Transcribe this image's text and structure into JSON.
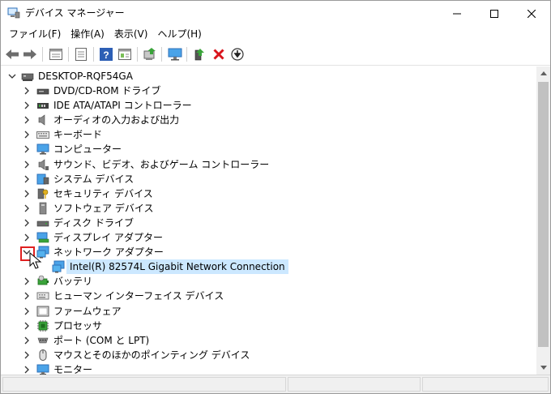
{
  "window": {
    "title": "デバイス マネージャー",
    "icon": "device-manager-icon"
  },
  "menu": [
    "ファイル(F)",
    "操作(A)",
    "表示(V)",
    "ヘルプ(H)"
  ],
  "toolbar": {
    "buttons": [
      "back-arrow-icon",
      "forward-arrow-icon",
      "properties-icon",
      "document-icon",
      "help-icon",
      "view-icon",
      "update-driver-icon",
      "monitor-icon",
      "enable-device-icon",
      "uninstall-x-icon",
      "download-driver-icon"
    ]
  },
  "tree": {
    "root": "DESKTOP-RQF54GA",
    "categories": [
      {
        "label": "DVD/CD-ROM ドライブ",
        "icon": "dvd-drive-icon"
      },
      {
        "label": "IDE ATA/ATAPI コントローラー",
        "icon": "ide-controller-icon"
      },
      {
        "label": "オーディオの入力および出力",
        "icon": "speaker-icon"
      },
      {
        "label": "キーボード",
        "icon": "keyboard-icon"
      },
      {
        "label": "コンピューター",
        "icon": "computer-icon"
      },
      {
        "label": "サウンド、ビデオ、およびゲーム コントローラー",
        "icon": "sound-icon"
      },
      {
        "label": "システム デバイス",
        "icon": "system-device-icon"
      },
      {
        "label": "セキュリティ デバイス",
        "icon": "security-key-icon"
      },
      {
        "label": "ソフトウェア デバイス",
        "icon": "software-device-icon"
      },
      {
        "label": "ディスク ドライブ",
        "icon": "disk-drive-icon"
      },
      {
        "label": "ディスプレイ アダプター",
        "icon": "display-adapter-icon"
      },
      {
        "label": "ネットワーク アダプター",
        "icon": "network-adapter-icon",
        "expanded": true,
        "children": [
          "Intel(R) 82574L Gigabit Network Connection"
        ]
      },
      {
        "label": "バッテリ",
        "icon": "battery-icon"
      },
      {
        "label": "ヒューマン インターフェイス デバイス",
        "icon": "hid-icon"
      },
      {
        "label": "ファームウェア",
        "icon": "firmware-icon"
      },
      {
        "label": "プロセッサ",
        "icon": "processor-icon"
      },
      {
        "label": "ポート (COM と LPT)",
        "icon": "port-icon"
      },
      {
        "label": "マウスとそのほかのポインティング デバイス",
        "icon": "mouse-icon"
      },
      {
        "label": "モニター",
        "icon": "monitor-icon"
      }
    ]
  },
  "colors": {
    "selection": "#cce8ff",
    "highlight_box": "#e02020",
    "accent_blue": "#2d7fd3"
  }
}
